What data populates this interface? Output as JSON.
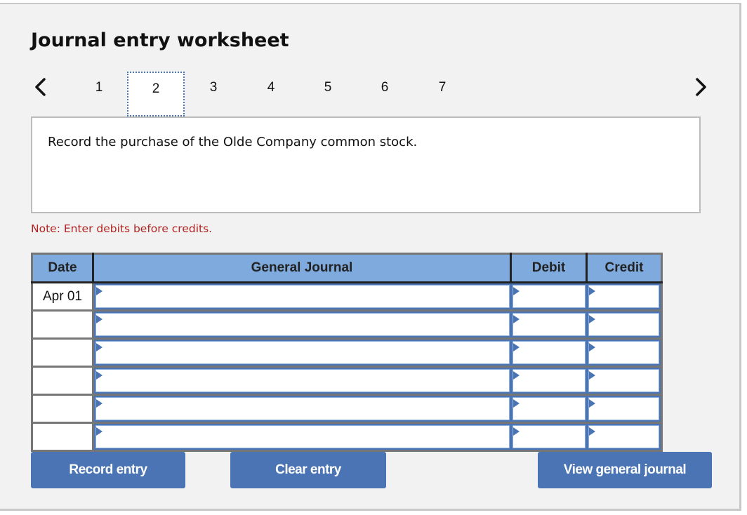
{
  "header": {
    "title": "Journal entry worksheet"
  },
  "navigation": {
    "prev_icon": "chevron-left-icon",
    "next_icon": "chevron-right-icon",
    "steps": [
      "1",
      "2",
      "3",
      "4",
      "5",
      "6",
      "7"
    ],
    "active_step": "2"
  },
  "prompt": {
    "text": "Record the purchase of the Olde Company common stock."
  },
  "note": {
    "text": "Note: Enter debits before credits."
  },
  "table": {
    "headers": {
      "date": "Date",
      "general_journal": "General Journal",
      "debit": "Debit",
      "credit": "Credit"
    },
    "rows": [
      {
        "date": "Apr 01",
        "account": "",
        "debit": "",
        "credit": ""
      },
      {
        "date": "",
        "account": "",
        "debit": "",
        "credit": ""
      },
      {
        "date": "",
        "account": "",
        "debit": "",
        "credit": ""
      },
      {
        "date": "",
        "account": "",
        "debit": "",
        "credit": ""
      },
      {
        "date": "",
        "account": "",
        "debit": "",
        "credit": ""
      },
      {
        "date": "",
        "account": "",
        "debit": "",
        "credit": ""
      }
    ]
  },
  "buttons": {
    "record_entry": "Record entry",
    "clear_entry": "Clear entry",
    "view_general_journal": "View general journal"
  },
  "colors": {
    "accent": "#4a74b4",
    "header_bg": "#7eaadd",
    "note_text": "#b22222"
  }
}
